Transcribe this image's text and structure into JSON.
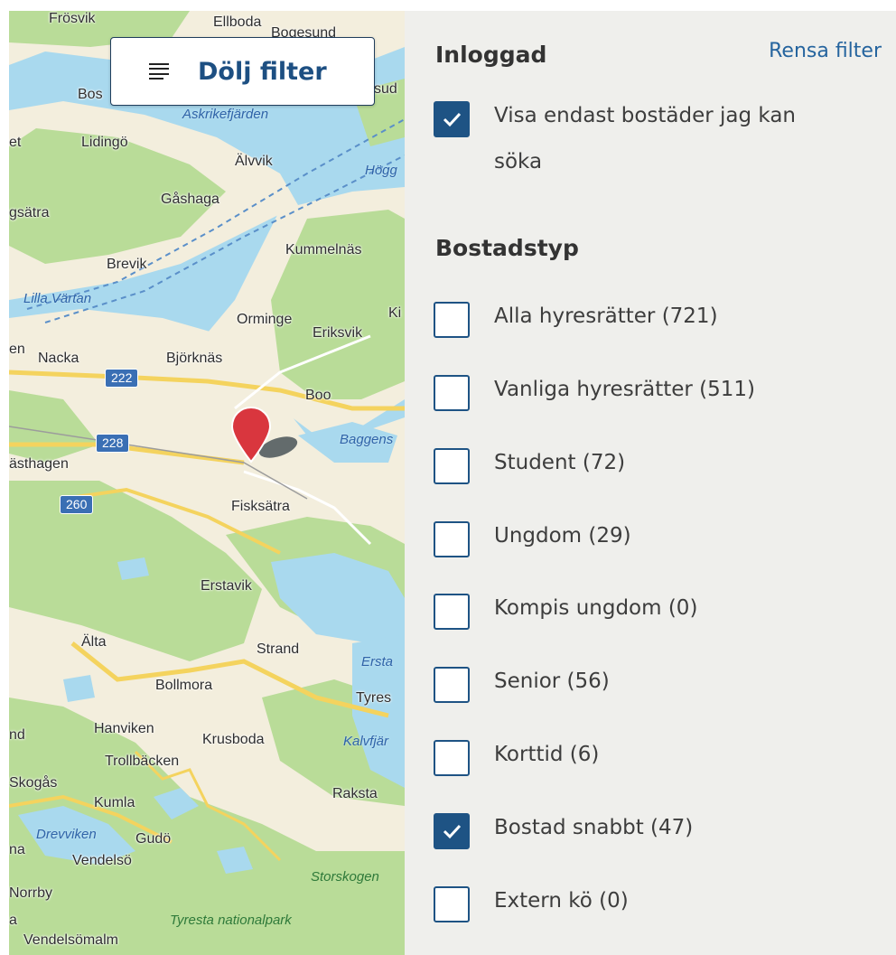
{
  "map": {
    "toggle_label": "Dölj filter",
    "places": [
      "Frösvik",
      "Ellboda",
      "Bogesund",
      "Bos",
      "sud",
      "et",
      "Lidingö",
      "Älvvik",
      "gsätra",
      "Gåshaga",
      "Kummelnäs",
      "Brevik",
      "Orminge",
      "Ki",
      "Eriksvik",
      "en",
      "Nacka",
      "Björknäs",
      "Boo",
      "ästhagen",
      "Fisksätra",
      "Erstavik",
      "Älta",
      "Strand",
      "Bollmora",
      "Tyres",
      "nd",
      "Hanviken",
      "Krusboda",
      "Trollbäcken",
      "Skogås",
      "Raksta",
      "Kumla",
      "Gudö",
      "na",
      "Vendelsö",
      "Norrby",
      "a",
      "Vendelsömalm"
    ],
    "waters": [
      "Askrikefjärden",
      "Högg",
      "Lilla Värtan",
      "Baggens",
      "Ersta",
      "Kalvfjär",
      "Drevviken"
    ],
    "parks": [
      "Storskogen",
      "Tyresta nationalpark"
    ],
    "roads": [
      "222",
      "228",
      "260"
    ]
  },
  "filters": {
    "clear_label": "Rensa filter",
    "logged_in": {
      "title": "Inloggad",
      "option": {
        "label": "Visa endast bostäder jag kan söka",
        "checked": true
      }
    },
    "housing_type": {
      "title": "Bostadstyp",
      "options": [
        {
          "label": "Alla hyresrätter (721)",
          "checked": false
        },
        {
          "label": "Vanliga hyresrätter (511)",
          "checked": false
        },
        {
          "label": "Student (72)",
          "checked": false
        },
        {
          "label": "Ungdom (29)",
          "checked": false
        },
        {
          "label": "Kompis ungdom (0)",
          "checked": false
        },
        {
          "label": "Senior (56)",
          "checked": false
        },
        {
          "label": "Korttid (6)",
          "checked": false
        },
        {
          "label": "Bostad snabbt (47)",
          "checked": true
        },
        {
          "label": "Extern kö (0)",
          "checked": false
        }
      ]
    }
  },
  "colors": {
    "accent": "#1e5384",
    "link": "#25649e",
    "pin": "#d9363e",
    "water": "#a9d9ee",
    "land": "#f3eedd",
    "forest": "#a8d48a"
  }
}
